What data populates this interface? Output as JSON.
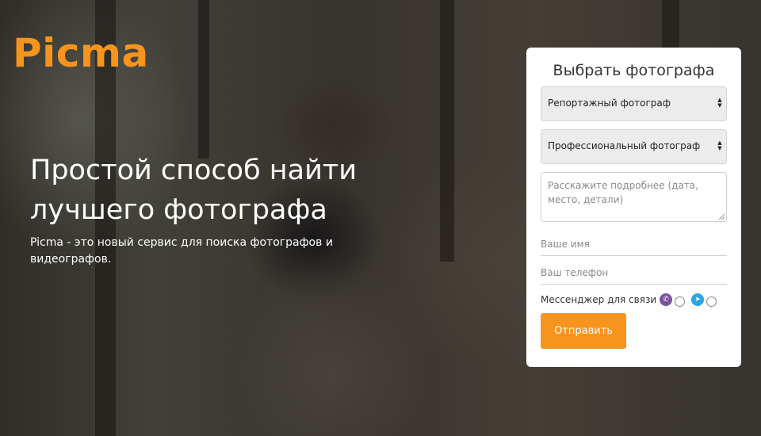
{
  "logo": {
    "text": "Picma"
  },
  "hero": {
    "headline": "Простой способ найти лучшего фотографа",
    "subtitle": "Picma - это новый сервис для поиска фотографов и видеографов."
  },
  "form": {
    "title": "Выбрать фотографа",
    "select_type": {
      "value": "Репортажный фотограф"
    },
    "select_level": {
      "value": "Профессиональный фотограф"
    },
    "details": {
      "placeholder": "Расскажите подробнее (дата, место, детали)"
    },
    "name": {
      "placeholder": "Ваше имя"
    },
    "phone": {
      "placeholder": "Ваш телефон"
    },
    "messenger": {
      "label": "Мессенджер для связи",
      "options": [
        {
          "icon": "viber-icon",
          "color": "#7b519d",
          "selected": false
        },
        {
          "icon": "telegram-icon",
          "color": "#2ca5e0",
          "selected": false
        }
      ]
    },
    "submit_label": "Отправить"
  },
  "colors": {
    "accent": "#f7941d",
    "card_bg": "#ffffff"
  }
}
